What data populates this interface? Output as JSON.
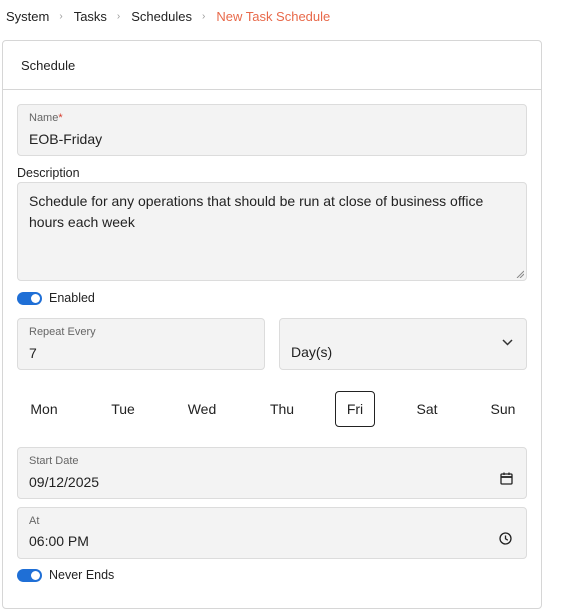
{
  "breadcrumb": {
    "items": [
      "System",
      "Tasks",
      "Schedules"
    ],
    "current": "New Task Schedule"
  },
  "card": {
    "title": "Schedule"
  },
  "form": {
    "name_label": "Name",
    "name_required_mark": "*",
    "name_value": "EOB-Friday",
    "description_label": "Description",
    "description_value": "Schedule for any operations that should be run at close of business office hours each week",
    "enabled_label": "Enabled",
    "enabled": true,
    "repeat_label": "Repeat Every",
    "repeat_value": "7",
    "interval_unit": "Day(s)",
    "days": [
      "Mon",
      "Tue",
      "Wed",
      "Thu",
      "Fri",
      "Sat",
      "Sun"
    ],
    "selected_day": "Fri",
    "start_date_label": "Start Date",
    "start_date_value": "09/12/2025",
    "at_label": "At",
    "at_value": "06:00 PM",
    "never_ends_label": "Never Ends",
    "never_ends": true
  },
  "colors": {
    "accent": "#1f6fd6",
    "breadcrumb_current": "#e8694a",
    "required": "#d63b2c",
    "field_bg": "#f3f3f3"
  },
  "icons": {
    "breadcrumb_separator": "chevron-right-icon",
    "select": "chevron-down-icon",
    "date": "calendar-icon",
    "time": "clock-icon"
  }
}
